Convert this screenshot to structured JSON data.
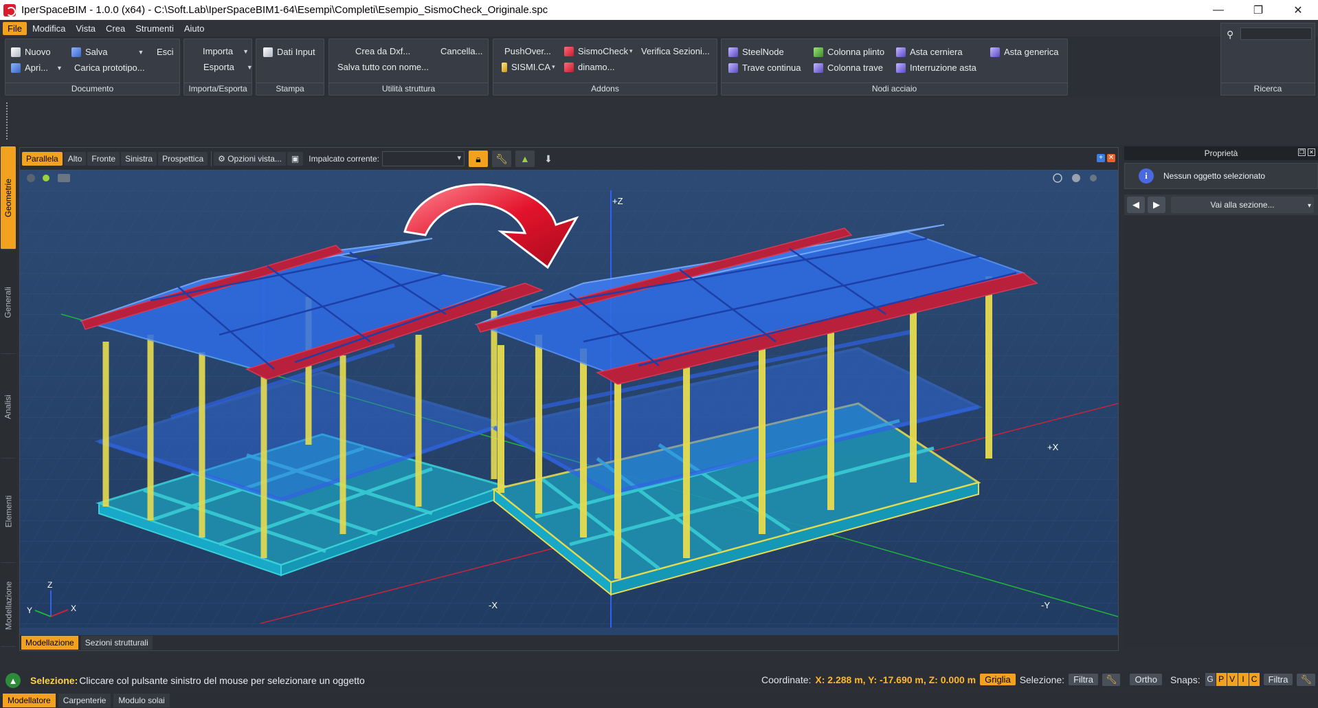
{
  "window": {
    "title": "IperSpaceBIM - 1.0.0 (x64) - C:\\Soft.Lab\\IperSpaceBIM1-64\\Esempi\\Completi\\Esempio_SismoCheck_Originale.spc",
    "minimize": "—",
    "maximize": "❐",
    "close": "✕"
  },
  "menu": [
    "File",
    "Modifica",
    "Vista",
    "Crea",
    "Strumenti",
    "Aiuto"
  ],
  "ribbon": {
    "documento": {
      "title": "Documento",
      "nuovo": "Nuovo",
      "salva": "Salva",
      "esci": "Esci",
      "apri": "Apri...",
      "carica": "Carica prototipo..."
    },
    "importa_esporta": {
      "title": "Importa/Esporta",
      "importa": "Importa",
      "esporta": "Esporta"
    },
    "stampa": {
      "title": "Stampa",
      "dati_input": "Dati Input"
    },
    "utilita": {
      "title": "Utilità struttura",
      "crea_dxf": "Crea da Dxf...",
      "cancella": "Cancella...",
      "salva_tutto": "Salva tutto con nome..."
    },
    "addons": {
      "title": "Addons",
      "pushover": "PushOver...",
      "sismocheck": "SismoCheck",
      "verifica": "Verifica Sezioni...",
      "sismica": "SISMI.CA",
      "dinamo": "dinamo..."
    },
    "nodi": {
      "title": "Nodi acciaio",
      "steelnode": "SteelNode",
      "colonna_plinto": "Colonna plinto",
      "asta_cerniera": "Asta cerniera",
      "asta_generica": "Asta generica",
      "trave_continua": "Trave continua",
      "colonna_trave": "Colonna trave",
      "interruzione": "Interruzione asta"
    },
    "ricerca": {
      "title": "Ricerca",
      "placeholder": ""
    }
  },
  "side_tabs": [
    "Geometrie",
    "Generali",
    "Analisi",
    "Elementi",
    "Modellazione"
  ],
  "view_toolbar": {
    "buttons": [
      "Parallela",
      "Alto",
      "Fronte",
      "Sinistra",
      "Prospettica"
    ],
    "opzioni": "Opzioni vista...",
    "impalcato_label": "Impalcato corrente:",
    "impalcato_value": ""
  },
  "scene": {
    "axis_z": "+Z",
    "axis_x_pos": "+X",
    "axis_x_neg": "-X",
    "axis_y_neg": "-Y",
    "triad_z": "Z",
    "triad_y": "Y",
    "triad_x": "X"
  },
  "bottom_tabs": [
    "Modellazione",
    "Sezioni strutturali"
  ],
  "properties": {
    "title": "Proprietà",
    "info": "Nessun oggetto selezionato",
    "goto": "Vai alla sezione..."
  },
  "status": {
    "sel_label": "Selezione:",
    "sel_text": "Cliccare col pulsante sinistro del mouse per selezionare un oggetto",
    "coord_label": "Coordinate:",
    "coord_value": "X: 2.288 m, Y: -17.690 m, Z: 0.000 m",
    "griglia": "Griglia",
    "selezione": "Selezione:",
    "filtra": "Filtra",
    "ortho": "Ortho",
    "snaps": "Snaps:",
    "snap_keys": [
      "G",
      "P",
      "V",
      "I",
      "C"
    ],
    "filtra2": "Filtra"
  },
  "modes": [
    "Modellatore",
    "Carpenterie",
    "Modulo solai"
  ],
  "colors": {
    "accent": "#f2a21e",
    "viewport_bg": "#27446d",
    "roof_blue": "#2f6de8",
    "roof_red": "#b8203c",
    "column_yellow": "#e6dc50",
    "foundation_cyan": "#39d0d8",
    "arrow_red": "#e3132c"
  }
}
